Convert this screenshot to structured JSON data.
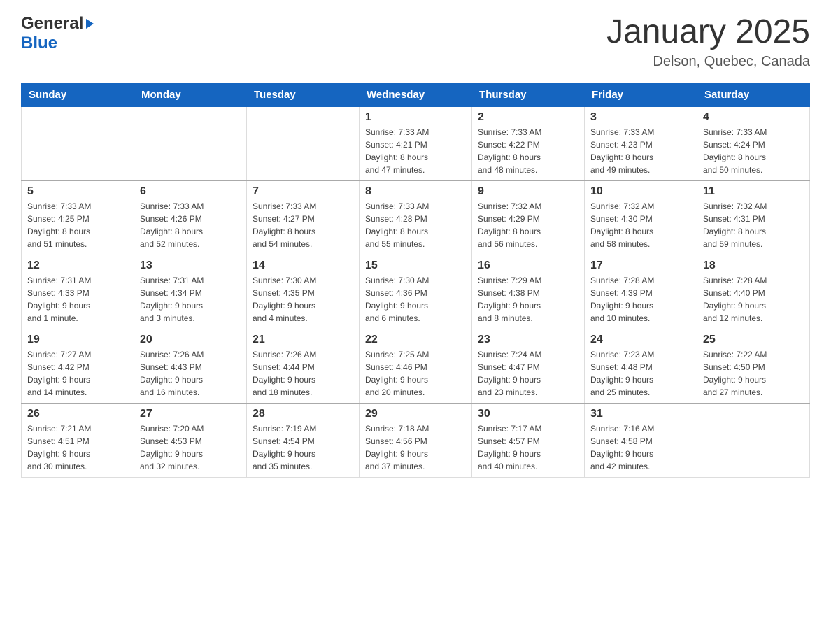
{
  "header": {
    "logo_general": "General",
    "logo_blue": "Blue",
    "title": "January 2025",
    "subtitle": "Delson, Quebec, Canada"
  },
  "columns": [
    "Sunday",
    "Monday",
    "Tuesday",
    "Wednesday",
    "Thursday",
    "Friday",
    "Saturday"
  ],
  "weeks": [
    [
      {
        "day": "",
        "info": ""
      },
      {
        "day": "",
        "info": ""
      },
      {
        "day": "",
        "info": ""
      },
      {
        "day": "1",
        "info": "Sunrise: 7:33 AM\nSunset: 4:21 PM\nDaylight: 8 hours\nand 47 minutes."
      },
      {
        "day": "2",
        "info": "Sunrise: 7:33 AM\nSunset: 4:22 PM\nDaylight: 8 hours\nand 48 minutes."
      },
      {
        "day": "3",
        "info": "Sunrise: 7:33 AM\nSunset: 4:23 PM\nDaylight: 8 hours\nand 49 minutes."
      },
      {
        "day": "4",
        "info": "Sunrise: 7:33 AM\nSunset: 4:24 PM\nDaylight: 8 hours\nand 50 minutes."
      }
    ],
    [
      {
        "day": "5",
        "info": "Sunrise: 7:33 AM\nSunset: 4:25 PM\nDaylight: 8 hours\nand 51 minutes."
      },
      {
        "day": "6",
        "info": "Sunrise: 7:33 AM\nSunset: 4:26 PM\nDaylight: 8 hours\nand 52 minutes."
      },
      {
        "day": "7",
        "info": "Sunrise: 7:33 AM\nSunset: 4:27 PM\nDaylight: 8 hours\nand 54 minutes."
      },
      {
        "day": "8",
        "info": "Sunrise: 7:33 AM\nSunset: 4:28 PM\nDaylight: 8 hours\nand 55 minutes."
      },
      {
        "day": "9",
        "info": "Sunrise: 7:32 AM\nSunset: 4:29 PM\nDaylight: 8 hours\nand 56 minutes."
      },
      {
        "day": "10",
        "info": "Sunrise: 7:32 AM\nSunset: 4:30 PM\nDaylight: 8 hours\nand 58 minutes."
      },
      {
        "day": "11",
        "info": "Sunrise: 7:32 AM\nSunset: 4:31 PM\nDaylight: 8 hours\nand 59 minutes."
      }
    ],
    [
      {
        "day": "12",
        "info": "Sunrise: 7:31 AM\nSunset: 4:33 PM\nDaylight: 9 hours\nand 1 minute."
      },
      {
        "day": "13",
        "info": "Sunrise: 7:31 AM\nSunset: 4:34 PM\nDaylight: 9 hours\nand 3 minutes."
      },
      {
        "day": "14",
        "info": "Sunrise: 7:30 AM\nSunset: 4:35 PM\nDaylight: 9 hours\nand 4 minutes."
      },
      {
        "day": "15",
        "info": "Sunrise: 7:30 AM\nSunset: 4:36 PM\nDaylight: 9 hours\nand 6 minutes."
      },
      {
        "day": "16",
        "info": "Sunrise: 7:29 AM\nSunset: 4:38 PM\nDaylight: 9 hours\nand 8 minutes."
      },
      {
        "day": "17",
        "info": "Sunrise: 7:28 AM\nSunset: 4:39 PM\nDaylight: 9 hours\nand 10 minutes."
      },
      {
        "day": "18",
        "info": "Sunrise: 7:28 AM\nSunset: 4:40 PM\nDaylight: 9 hours\nand 12 minutes."
      }
    ],
    [
      {
        "day": "19",
        "info": "Sunrise: 7:27 AM\nSunset: 4:42 PM\nDaylight: 9 hours\nand 14 minutes."
      },
      {
        "day": "20",
        "info": "Sunrise: 7:26 AM\nSunset: 4:43 PM\nDaylight: 9 hours\nand 16 minutes."
      },
      {
        "day": "21",
        "info": "Sunrise: 7:26 AM\nSunset: 4:44 PM\nDaylight: 9 hours\nand 18 minutes."
      },
      {
        "day": "22",
        "info": "Sunrise: 7:25 AM\nSunset: 4:46 PM\nDaylight: 9 hours\nand 20 minutes."
      },
      {
        "day": "23",
        "info": "Sunrise: 7:24 AM\nSunset: 4:47 PM\nDaylight: 9 hours\nand 23 minutes."
      },
      {
        "day": "24",
        "info": "Sunrise: 7:23 AM\nSunset: 4:48 PM\nDaylight: 9 hours\nand 25 minutes."
      },
      {
        "day": "25",
        "info": "Sunrise: 7:22 AM\nSunset: 4:50 PM\nDaylight: 9 hours\nand 27 minutes."
      }
    ],
    [
      {
        "day": "26",
        "info": "Sunrise: 7:21 AM\nSunset: 4:51 PM\nDaylight: 9 hours\nand 30 minutes."
      },
      {
        "day": "27",
        "info": "Sunrise: 7:20 AM\nSunset: 4:53 PM\nDaylight: 9 hours\nand 32 minutes."
      },
      {
        "day": "28",
        "info": "Sunrise: 7:19 AM\nSunset: 4:54 PM\nDaylight: 9 hours\nand 35 minutes."
      },
      {
        "day": "29",
        "info": "Sunrise: 7:18 AM\nSunset: 4:56 PM\nDaylight: 9 hours\nand 37 minutes."
      },
      {
        "day": "30",
        "info": "Sunrise: 7:17 AM\nSunset: 4:57 PM\nDaylight: 9 hours\nand 40 minutes."
      },
      {
        "day": "31",
        "info": "Sunrise: 7:16 AM\nSunset: 4:58 PM\nDaylight: 9 hours\nand 42 minutes."
      },
      {
        "day": "",
        "info": ""
      }
    ]
  ]
}
